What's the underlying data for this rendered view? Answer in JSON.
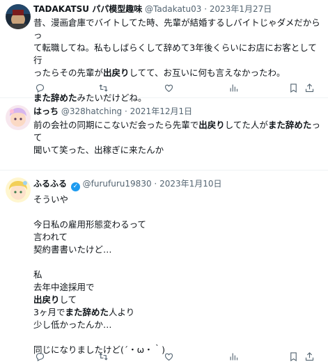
{
  "tweets": [
    {
      "name": "TADAKATSU パパ模型趣味",
      "handle": "@Tadakatu03",
      "date": "2023年1月27日",
      "lines": [
        {
          "a": "昔、漫画倉庫でバイトしてた時、先輩が結婚するしバイトじゃダメだからっ"
        },
        {
          "a": "て転職してね。私もしばらくして辞めて3年後くらいにお店にお客として行"
        },
        {
          "a": "ったらその先輩が",
          "b": "出戻り",
          "c": "してて、お互いに何も言えなかったわ。"
        },
        {
          "gap": true
        },
        {
          "b": "また辞めた",
          "c": "みたいだけどね。"
        }
      ]
    },
    {
      "name": "はっち",
      "handle": "@328hatching",
      "date": "2021年12月1日",
      "lines": [
        {
          "a": "前の会社の同期にこないだ会ったら先輩で",
          "b": "出戻り",
          "c": "してた人が",
          "d": "また辞めた",
          "e": "って"
        },
        {
          "a": "聞いて笑った、出稼ぎに来たんか"
        }
      ]
    },
    {
      "name": "ふるふる",
      "handle": "@furufuru19830",
      "date": "2023年1月10日",
      "lines": [
        {
          "a": "そういや"
        },
        {
          "gap": true
        },
        {
          "a": "今日私の雇用形態変わるって"
        },
        {
          "a": "言われて"
        },
        {
          "a": "契約書書いたけど…"
        },
        {
          "gap": true
        },
        {
          "a": "私"
        },
        {
          "a": "去年中途採用で"
        },
        {
          "b": "出戻り",
          "c": "して"
        },
        {
          "a": "3ヶ月で",
          "b": "また辞めた",
          "c": "人より"
        },
        {
          "a": "少し低かったんか…"
        },
        {
          "gap": true
        },
        {
          "a": "同じになりましたけど(´・ω・｀)"
        }
      ]
    }
  ],
  "icons": [
    "reply-icon",
    "retweet-icon",
    "like-icon",
    "views-icon",
    "bookmark-icon",
    "share-icon"
  ],
  "colors": {
    "text": "#0f1419",
    "meta": "#536471",
    "verified": "#1d9bf0",
    "divider": "#eff3f4"
  }
}
